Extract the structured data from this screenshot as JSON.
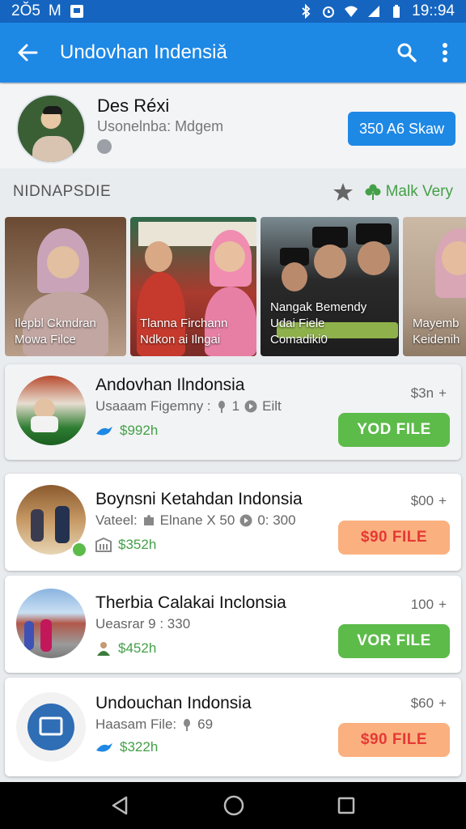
{
  "status_bar": {
    "time_left": "2Ŏ5",
    "carrier": "M",
    "time_right": "19::94"
  },
  "app_bar": {
    "title": "Undovhan Indensiǎ"
  },
  "profile": {
    "name": "Des Réxi",
    "subtitle": "Usonelnba: Mdgem",
    "cta_label": "350 A6 Skaw"
  },
  "section": {
    "label": "NIDNAPSDIE",
    "more_label": "Malk Very"
  },
  "carousel": [
    {
      "line1": "Ilepbl Ckmdran",
      "line2": "Mowa Filce"
    },
    {
      "line1": "Tlanna Firchann",
      "line2": "Ndkon ai Ilngai"
    },
    {
      "line1": "Nangak Bemendy",
      "line2": "Udai Fiele",
      "line3": "Comadiki0"
    },
    {
      "line1": "Mayemb",
      "line2": "Keidenih"
    }
  ],
  "items": [
    {
      "title": "Andovhan Ilndonsia",
      "meta": "Usaaam Figemny :",
      "meta2": "1",
      "meta3": "Eilt",
      "price": "$992h",
      "count": "$3n",
      "button": "YOD FILE"
    },
    {
      "title": "Boynsni Ketahdan Indonsia",
      "meta": "Vateel:",
      "meta2": "Elnane  X 50",
      "meta3": "0: 300",
      "price": "$352h",
      "count": "$00",
      "button": "$90 FILE"
    },
    {
      "title": "Therbia Calakai Inclonsia",
      "meta": "Ueasrar 9 :  330",
      "price": "$452h",
      "count": "100",
      "button": "VOR FILE"
    },
    {
      "title": "Undouchan Indonsia",
      "meta": "Haasam File:",
      "meta2": "69",
      "price": "$322h",
      "count": "$60",
      "button": "$90 FILE"
    }
  ],
  "colors": {
    "primary": "#1e88e5",
    "status": "#1565c0",
    "green": "#5dbb4a",
    "orange": "#fbb07f",
    "accent_red": "#e53935"
  }
}
